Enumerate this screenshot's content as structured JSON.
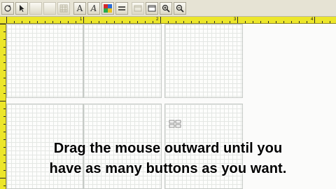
{
  "toolbar": {
    "buttons": [
      {
        "icon": "refresh-icon"
      },
      {
        "icon": "pointer-icon"
      },
      {
        "icon": "blank-icon"
      },
      {
        "icon": "blank-icon"
      },
      {
        "icon": "grid-icon"
      },
      {
        "icon": "text-icon",
        "glyph": "A"
      },
      {
        "icon": "text-style-icon",
        "glyph": "A"
      },
      {
        "icon": "color-palette-icon"
      },
      {
        "icon": "lines-icon"
      },
      {
        "icon": "window-icon"
      },
      {
        "icon": "window-icon"
      },
      {
        "icon": "zoom-in-icon"
      },
      {
        "icon": "zoom-out-icon"
      }
    ]
  },
  "ruler": {
    "marks": [
      "1",
      "2",
      "3",
      "4",
      "5"
    ]
  },
  "caption": {
    "line1": "Drag the mouse outward until you",
    "line2": "have as many buttons as you want."
  },
  "colors": {
    "ruler": "#ece62a",
    "toolbar": "#e6e3d4",
    "grid": "#e4e7e4"
  }
}
